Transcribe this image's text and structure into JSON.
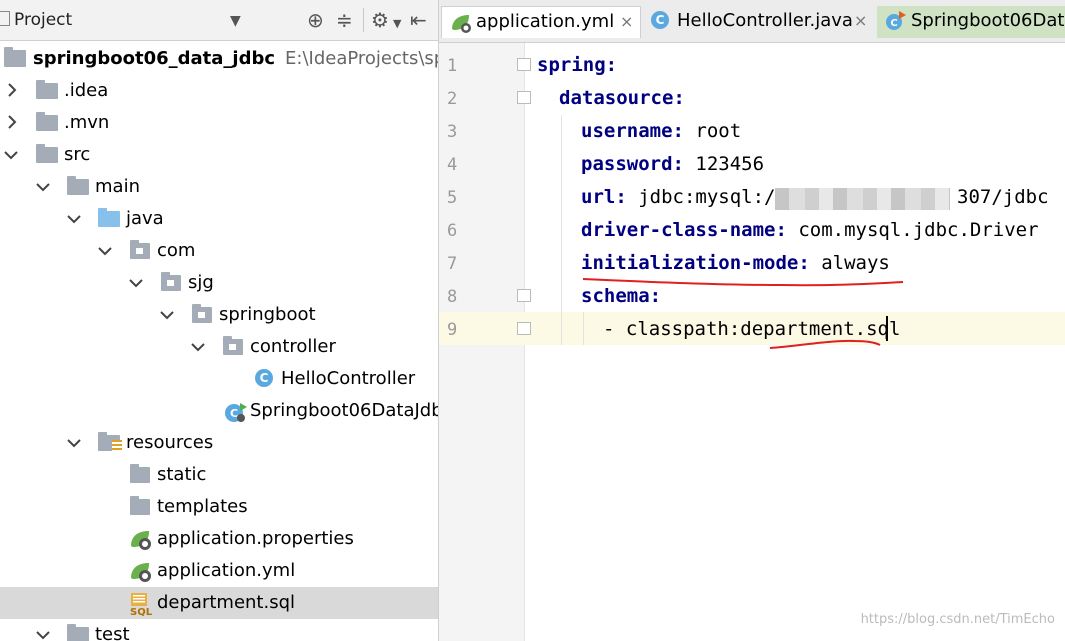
{
  "project_panel": {
    "title": "Project",
    "tree": [
      {
        "label": "springboot06_data_jdbc",
        "path": "E:\\IdeaProjects\\spring",
        "icon": "module-folder-icon",
        "expanded": true
      },
      {
        "label": ".idea",
        "icon": "folder-icon",
        "expanded": false
      },
      {
        "label": ".mvn",
        "icon": "folder-icon",
        "expanded": false
      },
      {
        "label": "src",
        "icon": "folder-icon",
        "expanded": true
      },
      {
        "label": "main",
        "icon": "folder-icon",
        "expanded": true
      },
      {
        "label": "java",
        "icon": "source-folder-icon",
        "expanded": true
      },
      {
        "label": "com",
        "icon": "package-icon",
        "expanded": true
      },
      {
        "label": "sjg",
        "icon": "package-icon",
        "expanded": true
      },
      {
        "label": "springboot",
        "icon": "package-icon",
        "expanded": true
      },
      {
        "label": "controller",
        "icon": "package-icon",
        "expanded": true
      },
      {
        "label": "HelloController",
        "icon": "class-icon"
      },
      {
        "label": "Springboot06DataJdb",
        "icon": "spring-boot-class-icon"
      },
      {
        "label": "resources",
        "icon": "resources-folder-icon",
        "expanded": true
      },
      {
        "label": "static",
        "icon": "folder-icon"
      },
      {
        "label": "templates",
        "icon": "folder-icon"
      },
      {
        "label": "application.properties",
        "icon": "spring-config-icon"
      },
      {
        "label": "application.yml",
        "icon": "spring-config-icon"
      },
      {
        "label": "department.sql",
        "icon": "sql-file-icon",
        "selected": true
      },
      {
        "label": "test",
        "icon": "folder-icon",
        "expanded": true
      }
    ]
  },
  "editor": {
    "tabs": [
      {
        "label": "application.yml",
        "icon": "spring-config-icon",
        "active": true,
        "close": "×"
      },
      {
        "label": "HelloController.java",
        "icon": "class-icon",
        "close": "×"
      },
      {
        "label": "Springboot06Dat",
        "icon": "spring-boot-class-icon"
      }
    ],
    "line_numbers": [
      "1",
      "2",
      "3",
      "4",
      "5",
      "6",
      "7",
      "8",
      "9"
    ],
    "lines": [
      {
        "key": "spring:",
        "value": ""
      },
      {
        "key": "datasource:",
        "value": ""
      },
      {
        "key": "username:",
        "value": " root"
      },
      {
        "key": "password:",
        "value": " 123456"
      },
      {
        "key": "url:",
        "value": " jdbc:mysql:/",
        "value2": "307/jdbc"
      },
      {
        "key": "driver-class-name:",
        "value": " com.mysql.jdbc.Driver"
      },
      {
        "key": "initialization-mode:",
        "value": " always"
      },
      {
        "key": "schema:",
        "value": ""
      },
      {
        "key": "",
        "value": "- classpath:department.sql"
      }
    ]
  },
  "watermark": "https://blog.csdn.net/TimEcho",
  "colors": {
    "yaml_key": "#000080",
    "annotation": "#e02020",
    "selection": "#d9d9d9",
    "current_line": "#fcf9e4"
  }
}
